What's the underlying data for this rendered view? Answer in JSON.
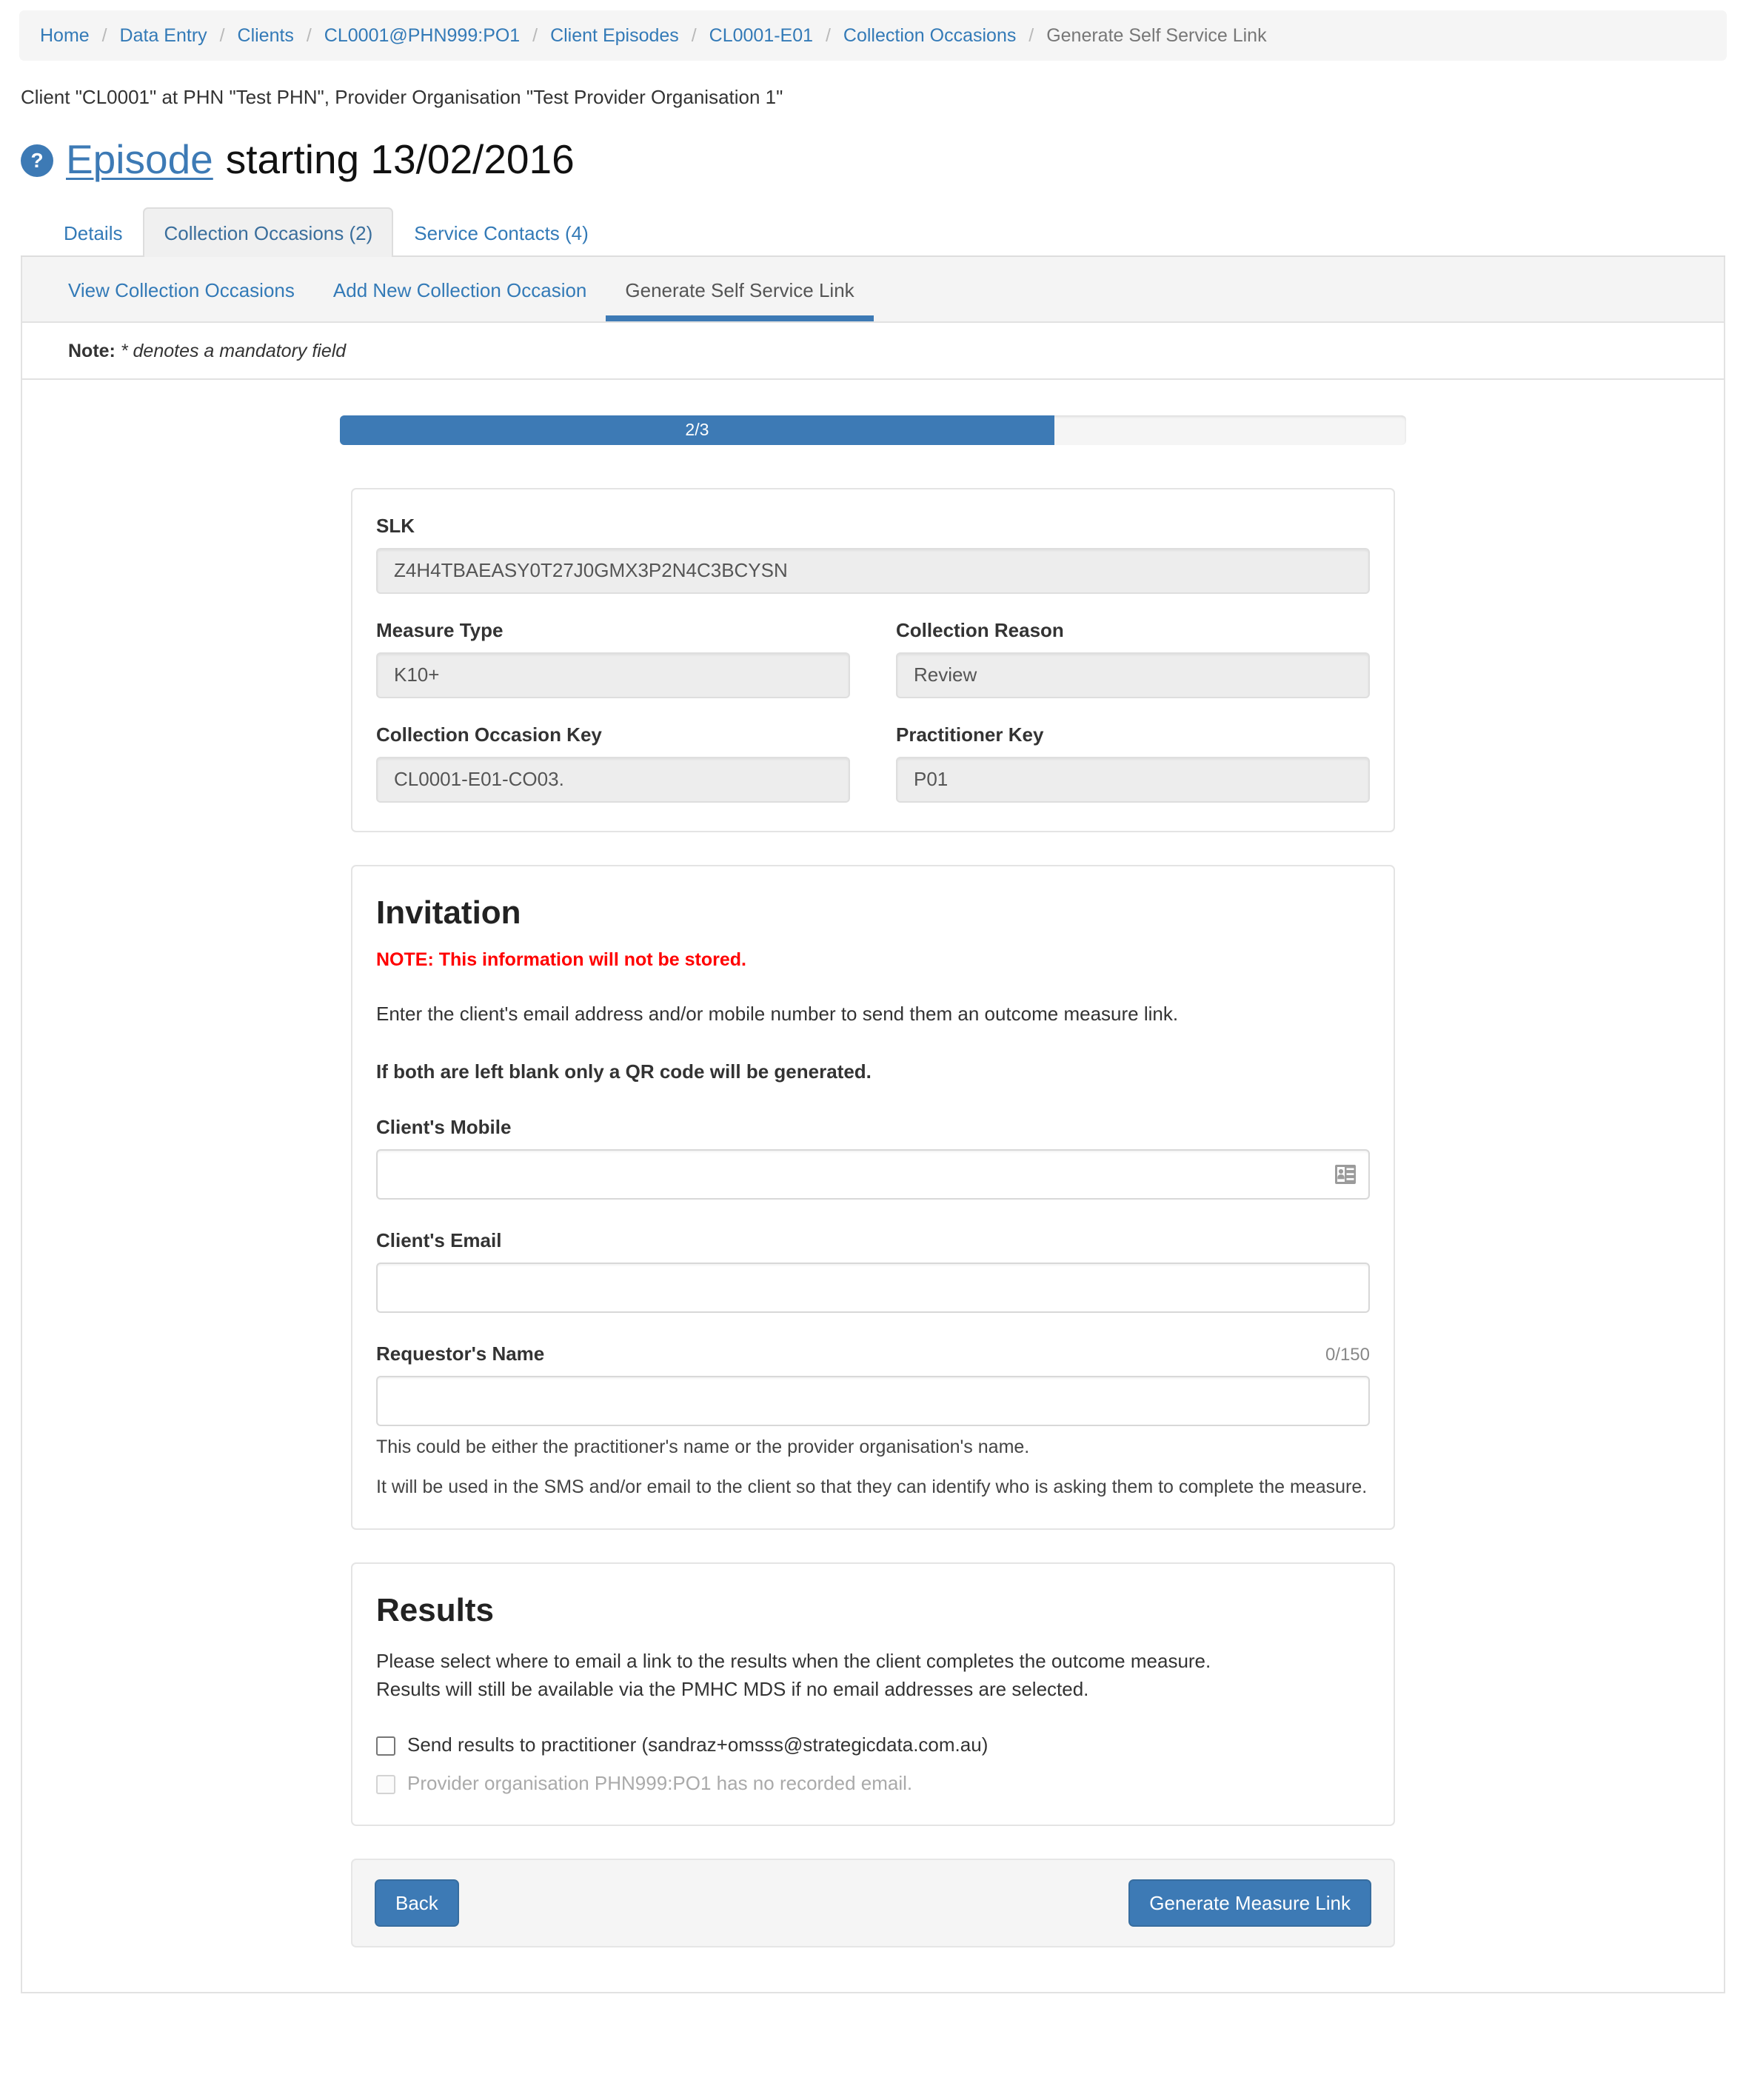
{
  "breadcrumb": {
    "items": [
      {
        "label": "Home",
        "current": false
      },
      {
        "label": "Data Entry",
        "current": false
      },
      {
        "label": "Clients",
        "current": false
      },
      {
        "label": "CL0001@PHN999:PO1",
        "current": false
      },
      {
        "label": "Client Episodes",
        "current": false
      },
      {
        "label": "CL0001-E01",
        "current": false
      },
      {
        "label": "Collection Occasions",
        "current": false
      },
      {
        "label": "Generate Self Service Link",
        "current": true
      }
    ]
  },
  "context_line": "Client \"CL0001\" at PHN \"Test PHN\", Provider Organisation \"Test Provider Organisation 1\"",
  "page_title": {
    "help_icon_glyph": "?",
    "link_text": "Episode",
    "rest_text": " starting 13/02/2016"
  },
  "primary_tabs": [
    {
      "label": "Details",
      "active": false
    },
    {
      "label": "Collection Occasions (2)",
      "active": true
    },
    {
      "label": "Service Contacts (4)",
      "active": false
    }
  ],
  "sub_tabs": [
    {
      "label": "View Collection Occasions",
      "active": false
    },
    {
      "label": "Add New Collection Occasion",
      "active": false
    },
    {
      "label": "Generate Self Service Link",
      "active": true
    }
  ],
  "note_bar": {
    "prefix": "Note:",
    "text": "* denotes a mandatory field"
  },
  "progress": {
    "label": "2/3",
    "percent": 67,
    "fill_color": "#3d7ab5"
  },
  "details_card": {
    "slk_label": "SLK",
    "slk_value": "Z4H4TBAEASY0T27J0GMX3P2N4C3BCYSN",
    "measure_type_label": "Measure Type",
    "measure_type_value": "K10+",
    "collection_reason_label": "Collection Reason",
    "collection_reason_value": "Review",
    "collection_occasion_key_label": "Collection Occasion Key",
    "collection_occasion_key_value": "CL0001-E01-CO03.",
    "practitioner_key_label": "Practitioner Key",
    "practitioner_key_value": "P01"
  },
  "invitation": {
    "title": "Invitation",
    "note": "NOTE: This information will not be stored.",
    "note_color": "#ff0000",
    "intro": "Enter the client's email address and/or mobile number to send them an outcome measure link.",
    "blank_note": "If both are left blank only a QR code will be generated.",
    "mobile_label": "Client's Mobile",
    "mobile_value": "",
    "mobile_placeholder": "",
    "email_label": "Client's Email",
    "email_value": "",
    "email_placeholder": "",
    "requestor_label": "Requestor's Name",
    "requestor_counter": "0/150",
    "requestor_value": "",
    "requestor_placeholder": "",
    "helper_1": "This could be either the practitioner's name or the provider organisation's name.",
    "helper_2": "It will be used in the SMS and/or email to the client so that they can identify who is asking them to complete the measure."
  },
  "results": {
    "title": "Results",
    "intro_line_1": "Please select where to email a link to the results when the client completes the outcome measure.",
    "intro_line_2": "Results will still be available via the PMHC MDS if no email addresses are selected.",
    "checkboxes": [
      {
        "label": "Send results to practitioner (sandraz+omsss@strategicdata.com.au)",
        "checked": false,
        "disabled": false
      },
      {
        "label": "Provider organisation PHN999:PO1 has no recorded email.",
        "checked": false,
        "disabled": true
      }
    ]
  },
  "footer": {
    "back_label": "Back",
    "generate_label": "Generate Measure Link"
  }
}
